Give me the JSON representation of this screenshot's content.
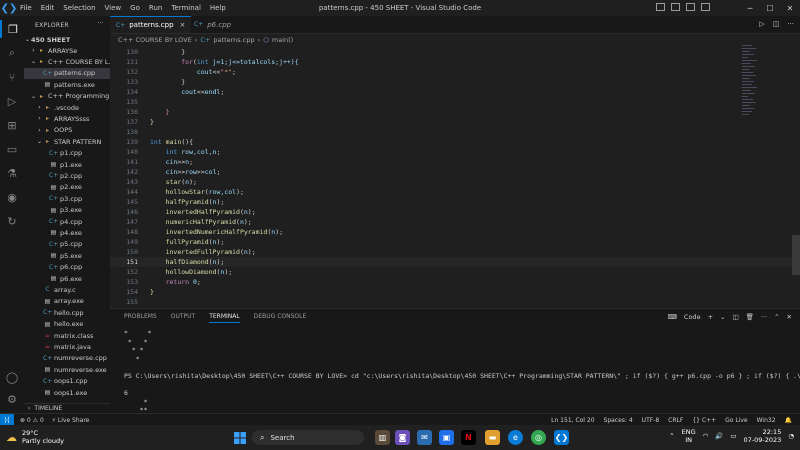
{
  "window": {
    "title": "patterns.cpp - 450 SHEET - Visual Studio Code",
    "menu": [
      "File",
      "Edit",
      "Selection",
      "View",
      "Go",
      "Run",
      "Terminal",
      "Help"
    ]
  },
  "explorer": {
    "header": "EXPLORER",
    "root": "450 SHEET",
    "timeline": "TIMELINE",
    "items": [
      {
        "label": "ARRAYSe",
        "kind": "folder",
        "depth": 1,
        "open": false
      },
      {
        "label": "C++ COURSE BY L...",
        "kind": "folder",
        "depth": 1,
        "open": true
      },
      {
        "label": "patterns.cpp",
        "kind": "cpp",
        "depth": 2,
        "selected": true
      },
      {
        "label": "patterns.exe",
        "kind": "exe",
        "depth": 2
      },
      {
        "label": "C++ Programming",
        "kind": "folder",
        "depth": 1,
        "open": true
      },
      {
        "label": ".vscode",
        "kind": "folder",
        "depth": 2,
        "open": false
      },
      {
        "label": "ARRAYSsss",
        "kind": "folder",
        "depth": 2,
        "open": false
      },
      {
        "label": "OOPS",
        "kind": "folder",
        "depth": 2,
        "open": false
      },
      {
        "label": "STAR PATTERN",
        "kind": "folder",
        "depth": 2,
        "open": true
      },
      {
        "label": "p1.cpp",
        "kind": "cpp",
        "depth": 3
      },
      {
        "label": "p1.exe",
        "kind": "exe",
        "depth": 3
      },
      {
        "label": "p2.cpp",
        "kind": "cpp",
        "depth": 3
      },
      {
        "label": "p2.exe",
        "kind": "exe",
        "depth": 3
      },
      {
        "label": "p3.cpp",
        "kind": "cpp",
        "depth": 3
      },
      {
        "label": "p3.exe",
        "kind": "exe",
        "depth": 3
      },
      {
        "label": "p4.cpp",
        "kind": "cpp",
        "depth": 3
      },
      {
        "label": "p4.exe",
        "kind": "exe",
        "depth": 3
      },
      {
        "label": "p5.cpp",
        "kind": "cpp",
        "depth": 3
      },
      {
        "label": "p5.exe",
        "kind": "exe",
        "depth": 3
      },
      {
        "label": "p6.cpp",
        "kind": "cpp",
        "depth": 3
      },
      {
        "label": "p6.exe",
        "kind": "exe",
        "depth": 3
      },
      {
        "label": "array.c",
        "kind": "c",
        "depth": 2
      },
      {
        "label": "array.exe",
        "kind": "exe",
        "depth": 2
      },
      {
        "label": "hello.cpp",
        "kind": "cpp",
        "depth": 2
      },
      {
        "label": "hello.exe",
        "kind": "exe",
        "depth": 2
      },
      {
        "label": "matrix.class",
        "kind": "java",
        "depth": 2
      },
      {
        "label": "matrix.java",
        "kind": "java",
        "depth": 2
      },
      {
        "label": "numreverse.cpp",
        "kind": "cpp",
        "depth": 2
      },
      {
        "label": "numreverse.exe",
        "kind": "exe",
        "depth": 2
      },
      {
        "label": "oops1.cpp",
        "kind": "cpp",
        "depth": 2
      },
      {
        "label": "oops1.exe",
        "kind": "exe",
        "depth": 2
      }
    ]
  },
  "tabs": [
    {
      "label": "patterns.cpp",
      "active": true,
      "close": "×"
    },
    {
      "label": "p6.cpp",
      "active": false
    }
  ],
  "breadcrumb": [
    "C++ COURSE BY LOVE",
    "›",
    "patterns.cpp",
    "›",
    "main()"
  ],
  "editor": {
    "current_line": 151,
    "lines": [
      {
        "n": "130",
        "indent": 8,
        "tokens": [
          {
            "t": "}",
            "c": ""
          }
        ]
      },
      {
        "n": "131",
        "indent": 8,
        "tokens": [
          {
            "t": "for",
            "c": "ctl"
          },
          {
            "t": "(",
            "c": ""
          },
          {
            "t": "int",
            "c": "kw"
          },
          {
            "t": " j=1;j<=totalcols;j++){",
            "c": "var"
          }
        ]
      },
      {
        "n": "132",
        "indent": 12,
        "tokens": [
          {
            "t": "cout",
            "c": "var"
          },
          {
            "t": "<<",
            "c": ""
          },
          {
            "t": "\"*\"",
            "c": "str"
          },
          {
            "t": ";",
            "c": ""
          }
        ]
      },
      {
        "n": "133",
        "indent": 8,
        "tokens": [
          {
            "t": "}",
            "c": ""
          }
        ]
      },
      {
        "n": "134",
        "indent": 8,
        "tokens": [
          {
            "t": "cout",
            "c": "var"
          },
          {
            "t": "<<",
            "c": ""
          },
          {
            "t": "endl",
            "c": "var"
          },
          {
            "t": ";",
            "c": ""
          }
        ]
      },
      {
        "n": "135",
        "indent": 0,
        "tokens": []
      },
      {
        "n": "136",
        "indent": 4,
        "tokens": [
          {
            "t": "}",
            "c": "ctl"
          }
        ]
      },
      {
        "n": "137",
        "indent": 0,
        "tokens": [
          {
            "t": "}",
            "c": "fn"
          }
        ]
      },
      {
        "n": "138",
        "indent": 0,
        "tokens": []
      },
      {
        "n": "139",
        "indent": 0,
        "tokens": [
          {
            "t": "int",
            "c": "kw"
          },
          {
            "t": " ",
            "c": ""
          },
          {
            "t": "main",
            "c": "fn"
          },
          {
            "t": "(){",
            "c": ""
          }
        ]
      },
      {
        "n": "140",
        "indent": 4,
        "tokens": [
          {
            "t": "int",
            "c": "kw"
          },
          {
            "t": " row,col,n;",
            "c": "var"
          }
        ]
      },
      {
        "n": "141",
        "indent": 4,
        "tokens": [
          {
            "t": "cin",
            "c": "var"
          },
          {
            "t": ">>",
            "c": ""
          },
          {
            "t": "n",
            "c": "var"
          },
          {
            "t": ";",
            "c": ""
          }
        ]
      },
      {
        "n": "142",
        "indent": 4,
        "tokens": [
          {
            "t": "cin",
            "c": "var"
          },
          {
            "t": ">>",
            "c": ""
          },
          {
            "t": "row",
            "c": "var"
          },
          {
            "t": ">>",
            "c": ""
          },
          {
            "t": "col",
            "c": "var"
          },
          {
            "t": ";",
            "c": ""
          }
        ]
      },
      {
        "n": "143",
        "indent": 4,
        "tokens": [
          {
            "t": "star",
            "c": "fn"
          },
          {
            "t": "(",
            "c": ""
          },
          {
            "t": "n",
            "c": "var"
          },
          {
            "t": ");",
            "c": ""
          }
        ]
      },
      {
        "n": "144",
        "indent": 4,
        "tokens": [
          {
            "t": "hollowStar",
            "c": "fn"
          },
          {
            "t": "(",
            "c": ""
          },
          {
            "t": "row,col",
            "c": "var"
          },
          {
            "t": ");",
            "c": ""
          }
        ]
      },
      {
        "n": "145",
        "indent": 4,
        "tokens": [
          {
            "t": "halfPyramid",
            "c": "fn"
          },
          {
            "t": "(",
            "c": ""
          },
          {
            "t": "n",
            "c": "var"
          },
          {
            "t": ");",
            "c": ""
          }
        ]
      },
      {
        "n": "146",
        "indent": 4,
        "tokens": [
          {
            "t": "invertedHalfPyramid",
            "c": "fn"
          },
          {
            "t": "(",
            "c": ""
          },
          {
            "t": "n",
            "c": "var"
          },
          {
            "t": ");",
            "c": ""
          }
        ]
      },
      {
        "n": "147",
        "indent": 4,
        "tokens": [
          {
            "t": "numericHalfPyramid",
            "c": "fn"
          },
          {
            "t": "(",
            "c": ""
          },
          {
            "t": "n",
            "c": "var"
          },
          {
            "t": ");",
            "c": ""
          }
        ]
      },
      {
        "n": "148",
        "indent": 4,
        "tokens": [
          {
            "t": "invertedNumericHalfPyramid",
            "c": "fn"
          },
          {
            "t": "(",
            "c": ""
          },
          {
            "t": "n",
            "c": "var"
          },
          {
            "t": ");",
            "c": ""
          }
        ]
      },
      {
        "n": "149",
        "indent": 4,
        "tokens": [
          {
            "t": "fullPyramid",
            "c": "fn"
          },
          {
            "t": "(",
            "c": ""
          },
          {
            "t": "n",
            "c": "var"
          },
          {
            "t": ");",
            "c": ""
          }
        ]
      },
      {
        "n": "150",
        "indent": 4,
        "tokens": [
          {
            "t": "invertedFullPyramid",
            "c": "fn"
          },
          {
            "t": "(",
            "c": ""
          },
          {
            "t": "n",
            "c": "var"
          },
          {
            "t": ");",
            "c": ""
          }
        ]
      },
      {
        "n": "151",
        "indent": 4,
        "tokens": [
          {
            "t": "halfDiamond",
            "c": "fn"
          },
          {
            "t": "(",
            "c": ""
          },
          {
            "t": "n",
            "c": "var"
          },
          {
            "t": ");",
            "c": ""
          }
        ]
      },
      {
        "n": "152",
        "indent": 4,
        "tokens": [
          {
            "t": "hollowDiamond",
            "c": "fn"
          },
          {
            "t": "(",
            "c": ""
          },
          {
            "t": "n",
            "c": "var"
          },
          {
            "t": ");",
            "c": ""
          }
        ]
      },
      {
        "n": "153",
        "indent": 4,
        "tokens": [
          {
            "t": "return",
            "c": "ctl"
          },
          {
            "t": " ",
            "c": ""
          },
          {
            "t": "0",
            "c": "var"
          },
          {
            "t": ";",
            "c": ""
          }
        ]
      },
      {
        "n": "154",
        "indent": 0,
        "tokens": [
          {
            "t": "}",
            "c": "fn"
          }
        ]
      },
      {
        "n": "155",
        "indent": 0,
        "tokens": []
      }
    ]
  },
  "panel": {
    "tabs": [
      "PROBLEMS",
      "OUTPUT",
      "TERMINAL",
      "DEBUG CONSOLE"
    ],
    "active_tab": "TERMINAL",
    "terminal_name": "Code",
    "terminal_lines": [
      "*     *",
      " *   *",
      "  * *",
      "   *",
      "",
      "PS C:\\Users\\rishita\\Desktop\\450 SHEET\\C++ COURSE BY LOVE> cd \"c:\\Users\\rishita\\Desktop\\450 SHEET\\C++ Programming\\STAR PATTERN\\\" ; if ($?) { g++ p6.cpp -o p6 } ; if ($?) { .\\p6 }",
      "",
      "6",
      "     *",
      "    **"
    ]
  },
  "statusbar": {
    "left": [
      "⊗ 0  ⚠ 0",
      "⚡ Live Share"
    ],
    "right": [
      "Ln 151, Col 20",
      "Spaces: 4",
      "UTF-8",
      "CRLF",
      "{} C++",
      "Go Live",
      "Win32"
    ]
  },
  "taskbar": {
    "temperature": "29°C",
    "condition": "Partly cloudy",
    "search_placeholder": "Search",
    "lang_top": "ENG",
    "lang_bottom": "IN",
    "time": "22:15",
    "date": "07-09-2023"
  },
  "colors": {
    "accent": "#0078d4",
    "editor_bg": "#1f1f1f",
    "function": "#dcdcaa",
    "keyword": "#569cd6",
    "string": "#ce9178",
    "variable": "#9cdcfe"
  }
}
